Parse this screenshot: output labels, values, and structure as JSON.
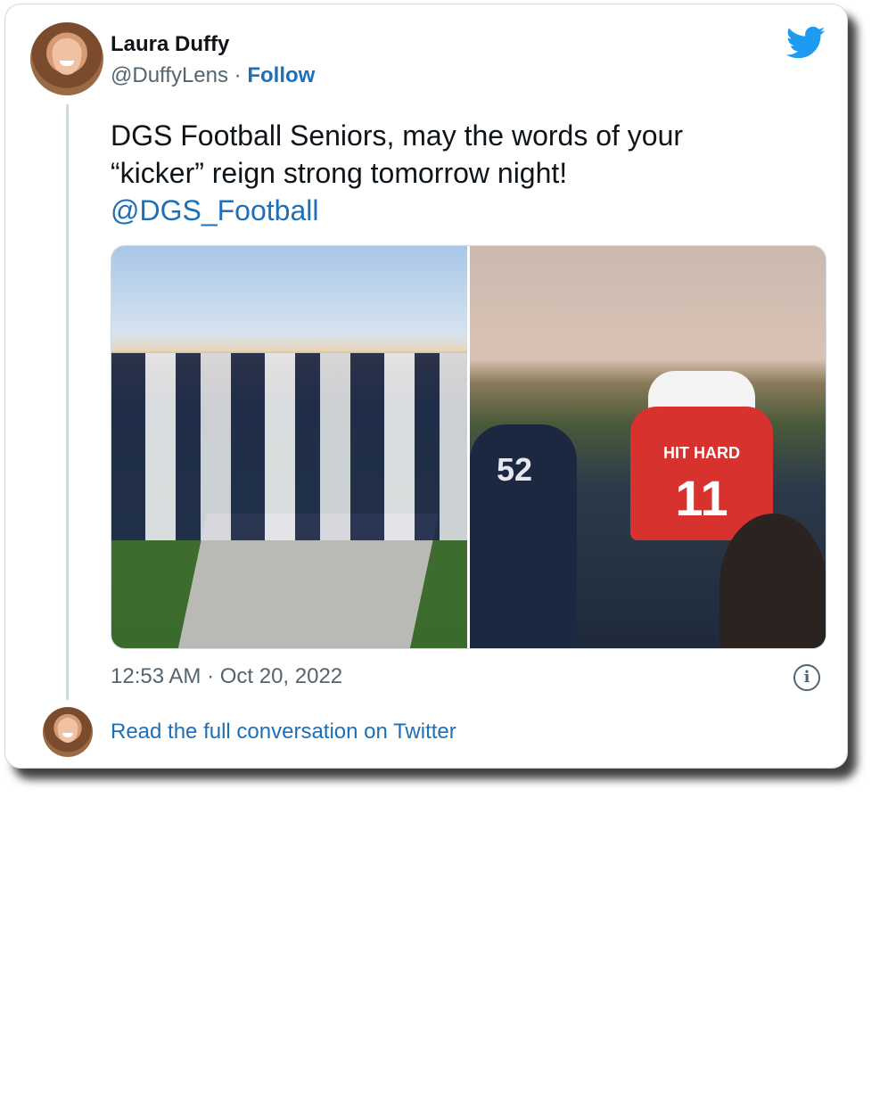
{
  "tweet": {
    "author_name": "Laura Duffy",
    "author_handle": "@DuffyLens",
    "separator": "·",
    "follow_label": "Follow",
    "text_line1": "DGS Football Seniors, may the words of your",
    "text_line2": "“kicker” reign strong tomorrow night!",
    "mention": "@DGS_Football",
    "timestamp": "12:53 AM · Oct 20, 2022",
    "read_more_label": "Read the full conversation on Twitter"
  },
  "media": {
    "photo_right": {
      "jersey_text": "HIT HARD",
      "jersey_number": "11",
      "player_left_number": "52"
    }
  },
  "icons": {
    "brand": "twitter-bird-icon",
    "info": "info-icon"
  },
  "colors": {
    "link": "#1d6fb8",
    "text": "#0f1419",
    "secondary": "#536471",
    "twitter_blue": "#1d9bf0"
  }
}
